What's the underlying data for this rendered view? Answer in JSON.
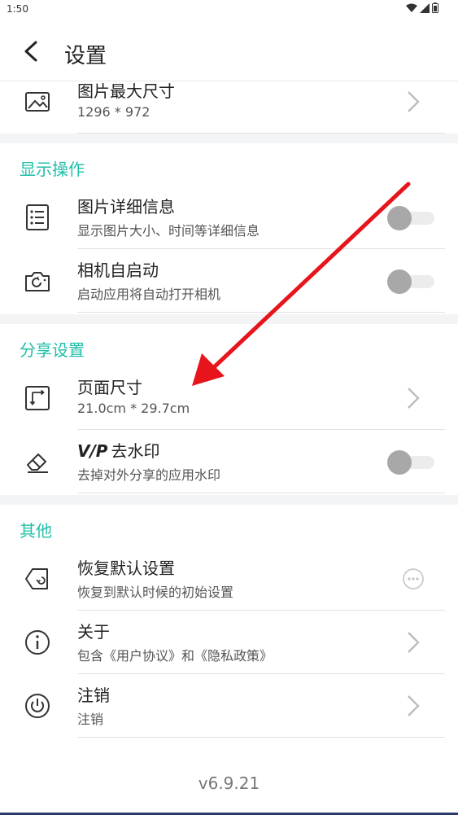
{
  "status": {
    "time": "1:50"
  },
  "header": {
    "title": "设置"
  },
  "image": {
    "max_size": {
      "title": "图片最大尺寸",
      "subtitle": "1296 * 972"
    }
  },
  "display": {
    "section_title": "显示操作",
    "details": {
      "title": "图片详细信息",
      "subtitle": "显示图片大小、时间等详细信息"
    },
    "camera": {
      "title": "相机自启动",
      "subtitle": "启动应用将自动打开相机"
    }
  },
  "share": {
    "section_title": "分享设置",
    "page_size": {
      "title": "页面尺寸",
      "subtitle": "21.0cm * 29.7cm"
    },
    "watermark": {
      "badge": "V/P",
      "title": "去水印",
      "subtitle": "去掉对外分享的应用水印"
    }
  },
  "other": {
    "section_title": "其他",
    "reset": {
      "title": "恢复默认设置",
      "subtitle": "恢复到默认时候的初始设置"
    },
    "about": {
      "title": "关于",
      "subtitle": "包含《用户协议》和《隐私政策》"
    },
    "logout": {
      "title": "注销",
      "subtitle": "注销"
    }
  },
  "version": "v6.9.21",
  "colors": {
    "accent": "#1fbfa8",
    "arrow": "#e8141c"
  }
}
